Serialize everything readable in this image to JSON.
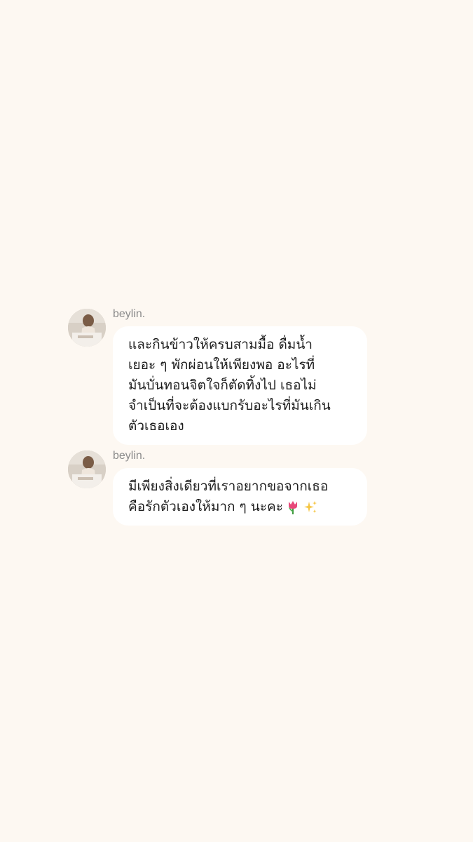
{
  "messages": [
    {
      "sender": "beylin.",
      "lines": [
        "และกินข้าวให้ครบสามมื้อ ดื่มน้ำ",
        "เยอะ ๆ พักผ่อนให้เพียงพอ อะไรที่",
        "มันบั่นทอนจิตใจก็ตัดทิ้งไป เธอไม่",
        "จำเป็นที่จะต้องแบกรับอะไรที่มันเกิน",
        "ตัวเธอเอง"
      ]
    },
    {
      "sender": "beylin.",
      "lines": [
        "มีเพียงสิ่งเดียวที่เราอยากขอจากเธอ",
        "คือรักตัวเองให้มาก ๆ นะคะ"
      ],
      "emojis": [
        "tulip-icon",
        "sparkles-icon"
      ]
    }
  ],
  "colors": {
    "background": "#fdf8f2",
    "bubble": "#ffffff",
    "sender_text": "#8a8a8a",
    "message_text": "#1c1c1c"
  }
}
